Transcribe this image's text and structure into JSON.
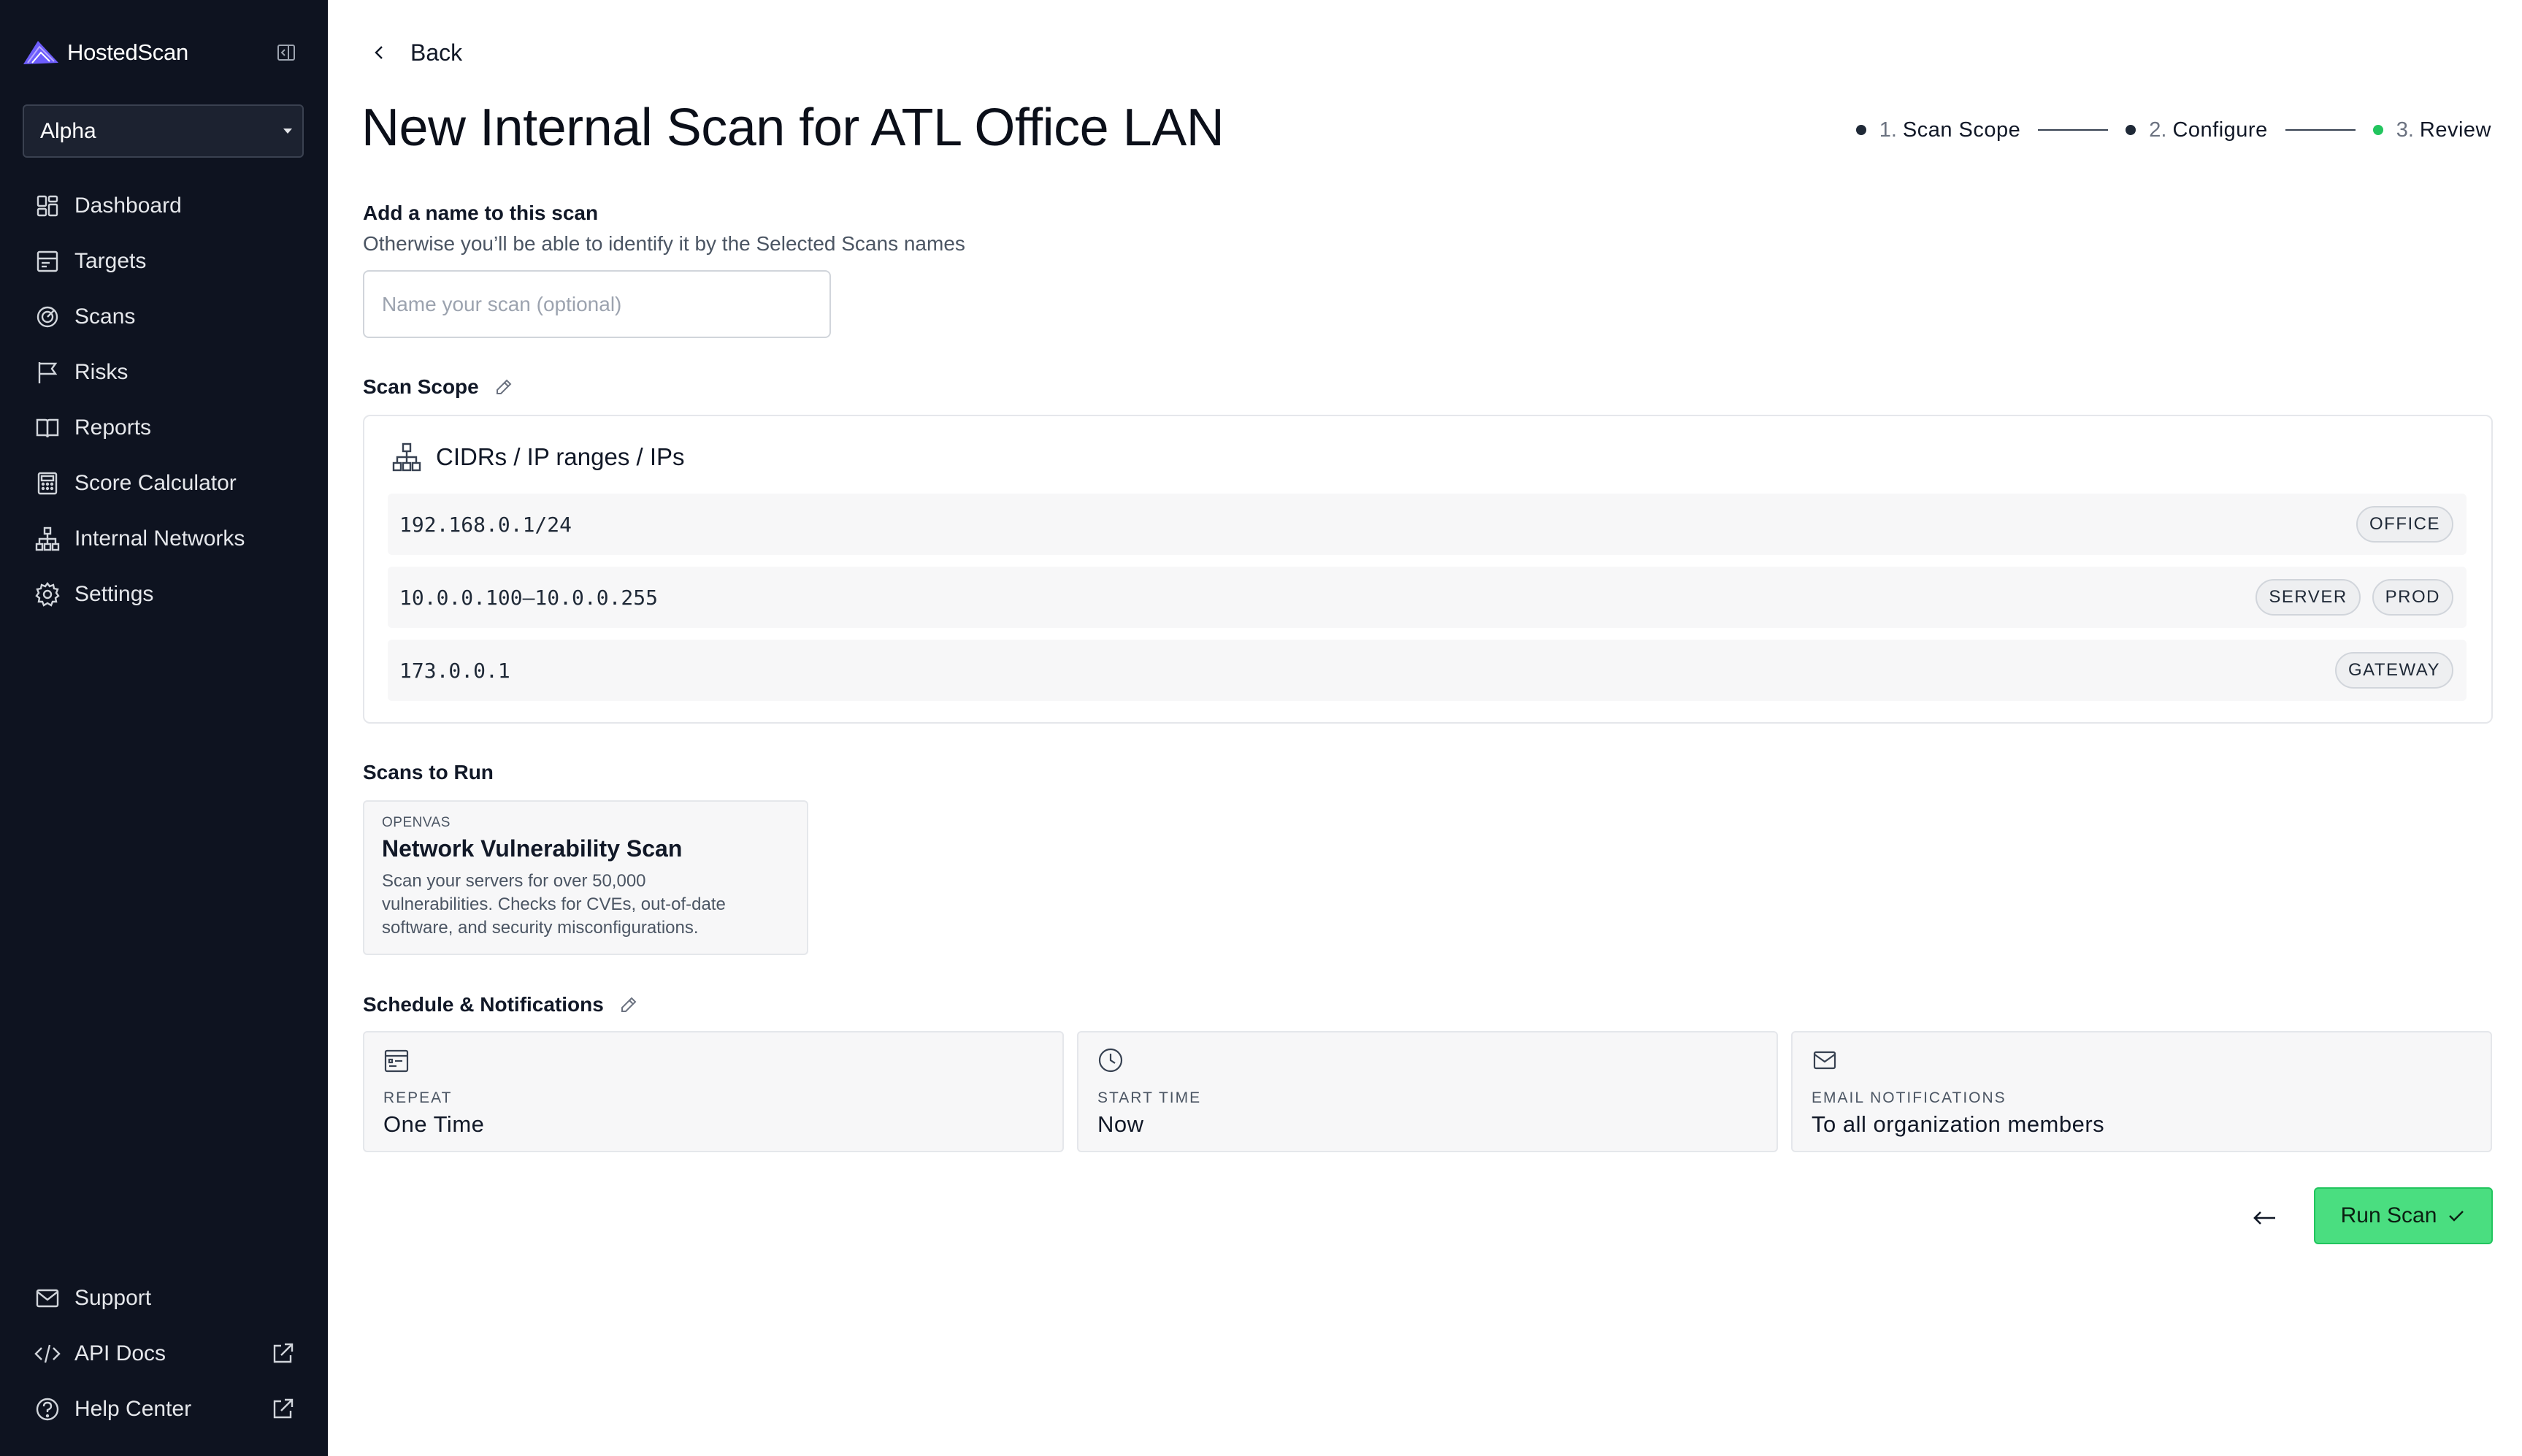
{
  "app": {
    "brand": "HostedScan"
  },
  "sidebar": {
    "org_selector": "Alpha",
    "nav": [
      {
        "label": "Dashboard",
        "icon": "dashboard-icon"
      },
      {
        "label": "Targets",
        "icon": "targets-icon"
      },
      {
        "label": "Scans",
        "icon": "scans-icon"
      },
      {
        "label": "Risks",
        "icon": "flag-icon"
      },
      {
        "label": "Reports",
        "icon": "book-icon"
      },
      {
        "label": "Score Calculator",
        "icon": "calculator-icon"
      },
      {
        "label": "Internal Networks",
        "icon": "network-icon"
      },
      {
        "label": "Settings",
        "icon": "gear-icon"
      }
    ],
    "bottom": [
      {
        "label": "Support",
        "icon": "mail-icon"
      },
      {
        "label": "API Docs",
        "icon": "code-icon"
      },
      {
        "label": "Help Center",
        "icon": "help-icon"
      }
    ]
  },
  "header": {
    "back_label": "Back",
    "title": "New Internal Scan for ATL Office LAN"
  },
  "stepper": {
    "steps": [
      {
        "num": "1.",
        "label": "Scan Scope",
        "status": "done"
      },
      {
        "num": "2.",
        "label": "Configure",
        "status": "done"
      },
      {
        "num": "3.",
        "label": "Review",
        "status": "current"
      }
    ],
    "current_color": "#22c55e"
  },
  "name_section": {
    "label": "Add a name to this scan",
    "help": "Otherwise you’ll be able to identify it by the Selected Scans names",
    "placeholder": "Name your scan (optional)",
    "value": ""
  },
  "scope": {
    "label": "Scan Scope",
    "box_title": "CIDRs / IP ranges / IPs",
    "rows": [
      {
        "ip": "192.168.0.1/24",
        "tags": [
          "OFFICE"
        ]
      },
      {
        "ip": "10.0.0.100–10.0.0.255",
        "tags": [
          "SERVER",
          "PROD"
        ]
      },
      {
        "ip": "173.0.0.1",
        "tags": [
          "GATEWAY"
        ]
      }
    ]
  },
  "scans": {
    "label": "Scans to Run",
    "card": {
      "kicker": "OPENVAS",
      "title": "Network Vulnerability Scan",
      "desc_lines": [
        "Scan your servers for over 50,000",
        "vulnerabilities. Checks for CVEs, out-of-date",
        "software, and security misconfigurations."
      ]
    }
  },
  "schedule": {
    "label": "Schedule & Notifications",
    "repeat": {
      "key": "REPEAT",
      "value": "One Time",
      "icon": "calendar-icon"
    },
    "start": {
      "key": "START TIME",
      "value": "Now",
      "icon": "clock-icon"
    },
    "email": {
      "key": "EMAIL NOTIFICATIONS",
      "value": "To all organization members",
      "icon": "mail-icon"
    }
  },
  "actions": {
    "run_label": "Run Scan",
    "run_color": "#4ade80"
  }
}
